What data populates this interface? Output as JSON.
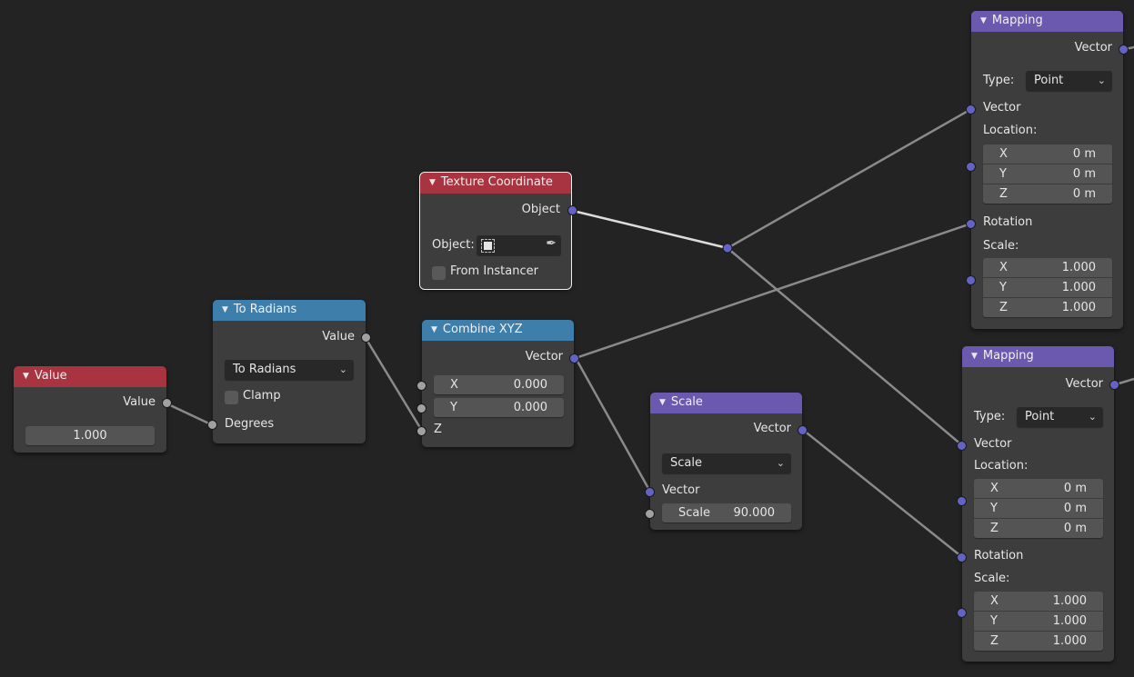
{
  "editor": "Shader Node Editor",
  "colors": {
    "background": "#232323",
    "node_body": "#3d3d3d",
    "header_input": "#a83341",
    "header_converter": "#3d7eab",
    "header_vector": "#6a59ae",
    "socket_float": "#a1a1a1",
    "socket_vector": "#6363c7",
    "link": "#8a8a8a"
  },
  "nodes": {
    "value": {
      "title": "Value",
      "output": "Value",
      "value": "1.000"
    },
    "to_radians": {
      "title": "To Radians",
      "output": "Value",
      "operation": "To Radians",
      "clamp_label": "Clamp",
      "clamp_checked": false,
      "input": "Degrees"
    },
    "texture_coordinate": {
      "title": "Texture Coordinate",
      "output": "Object",
      "object_label": "Object:",
      "object_value": "",
      "from_instancer_label": "From Instancer",
      "from_instancer_checked": false
    },
    "combine_xyz": {
      "title": "Combine XYZ",
      "output": "Vector",
      "x_label": "X",
      "x_value": "0.000",
      "y_label": "Y",
      "y_value": "0.000",
      "z_label": "Z"
    },
    "scale": {
      "title": "Scale",
      "output": "Vector",
      "operation": "Scale",
      "vector_label": "Vector",
      "scale_label": "Scale",
      "scale_value": "90.000"
    },
    "mapping_top": {
      "title": "Mapping",
      "output": "Vector",
      "type_label": "Type:",
      "type_value": "Point",
      "vector_label": "Vector",
      "location_label": "Location:",
      "location": [
        {
          "axis": "X",
          "value": "0 m"
        },
        {
          "axis": "Y",
          "value": "0 m"
        },
        {
          "axis": "Z",
          "value": "0 m"
        }
      ],
      "rotation_label": "Rotation",
      "scale_label": "Scale:",
      "scale": [
        {
          "axis": "X",
          "value": "1.000"
        },
        {
          "axis": "Y",
          "value": "1.000"
        },
        {
          "axis": "Z",
          "value": "1.000"
        }
      ]
    },
    "mapping_bottom": {
      "title": "Mapping",
      "output": "Vector",
      "type_label": "Type:",
      "type_value": "Point",
      "vector_label": "Vector",
      "location_label": "Location:",
      "location": [
        {
          "axis": "X",
          "value": "0 m"
        },
        {
          "axis": "Y",
          "value": "0 m"
        },
        {
          "axis": "Z",
          "value": "0 m"
        }
      ],
      "rotation_label": "Rotation",
      "scale_label": "Scale:",
      "scale": [
        {
          "axis": "X",
          "value": "1.000"
        },
        {
          "axis": "Y",
          "value": "1.000"
        },
        {
          "axis": "Z",
          "value": "1.000"
        }
      ]
    }
  },
  "links": [
    {
      "from": "value.Value",
      "to": "to_radians.Degrees"
    },
    {
      "from": "to_radians.Value",
      "to": "combine_xyz.Z"
    },
    {
      "from": "texture_coordinate.Object",
      "to": "reroute"
    },
    {
      "from": "reroute",
      "to": "mapping_top.Vector"
    },
    {
      "from": "reroute",
      "to": "mapping_bottom.Vector"
    },
    {
      "from": "combine_xyz.Vector",
      "to": "mapping_top.Rotation"
    },
    {
      "from": "combine_xyz.Vector",
      "to": "scale.Vector"
    },
    {
      "from": "scale.Vector",
      "to": "mapping_bottom.Rotation"
    }
  ]
}
